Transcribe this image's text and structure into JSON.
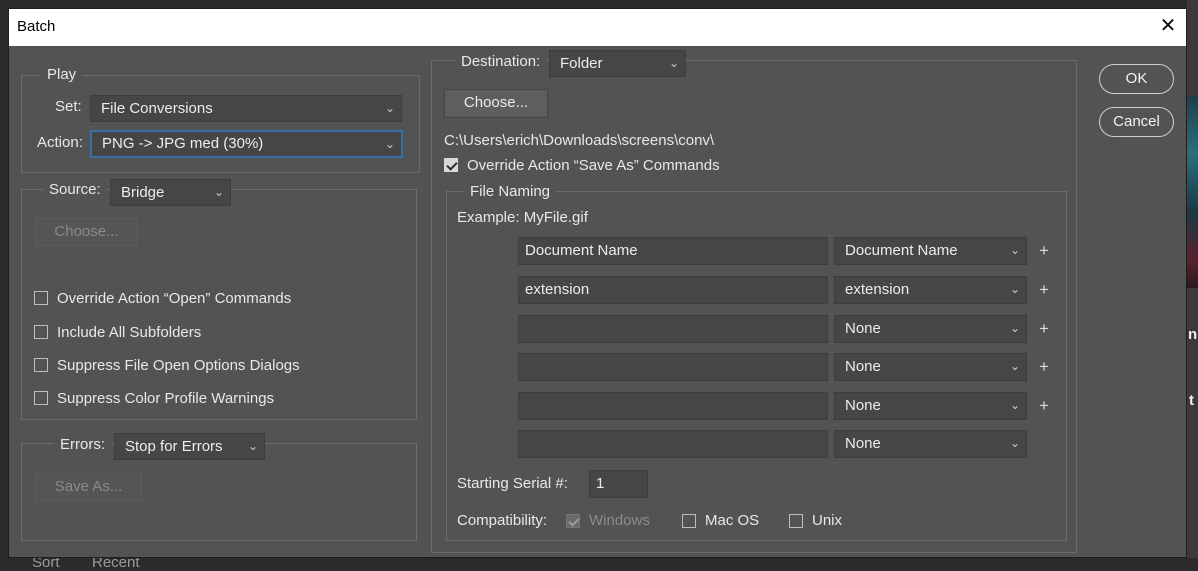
{
  "dialog": {
    "title": "Batch",
    "close_glyph": "✕"
  },
  "background": {
    "sort_label": "Sort",
    "recent_label": "Recent",
    "edge_text_1": "n",
    "edge_text_2": "t"
  },
  "play": {
    "legend": "Play",
    "set_label": "Set:",
    "set_value": "File Conversions",
    "action_label": "Action:",
    "action_value": "PNG -> JPG med (30%)"
  },
  "source": {
    "label": "Source:",
    "value": "Bridge",
    "choose_label": "Choose...",
    "options": [
      {
        "label": "Override Action “Open” Commands",
        "checked": false
      },
      {
        "label": "Include All Subfolders",
        "checked": false
      },
      {
        "label": "Suppress File Open Options Dialogs",
        "checked": false
      },
      {
        "label": "Suppress Color Profile Warnings",
        "checked": false
      }
    ]
  },
  "errors": {
    "label": "Errors:",
    "value": "Stop for Errors",
    "save_as_label": "Save As..."
  },
  "destination": {
    "label": "Destination:",
    "value": "Folder",
    "choose_label": "Choose...",
    "path": "C:\\Users\\erich\\Downloads\\screens\\conv\\",
    "override_label": "Override Action “Save As” Commands",
    "override_checked": true
  },
  "file_naming": {
    "legend": "File Naming",
    "example": "Example: MyFile.gif",
    "rows": [
      {
        "text": "Document Name",
        "select": "Document Name",
        "plus": "+"
      },
      {
        "text": "extension",
        "select": "extension",
        "plus": "+"
      },
      {
        "text": "",
        "select": "None",
        "plus": "+"
      },
      {
        "text": "",
        "select": "None",
        "plus": "+"
      },
      {
        "text": "",
        "select": "None",
        "plus": "+"
      },
      {
        "text": "",
        "select": "None",
        "plus": ""
      }
    ],
    "serial_label": "Starting Serial #:",
    "serial_value": "1",
    "compat_label": "Compatibility:",
    "compat": [
      {
        "label": "Windows",
        "checked": true,
        "disabled": true
      },
      {
        "label": "Mac OS",
        "checked": false,
        "disabled": false
      },
      {
        "label": "Unix",
        "checked": false,
        "disabled": false
      }
    ]
  },
  "buttons": {
    "ok": "OK",
    "cancel": "Cancel"
  }
}
